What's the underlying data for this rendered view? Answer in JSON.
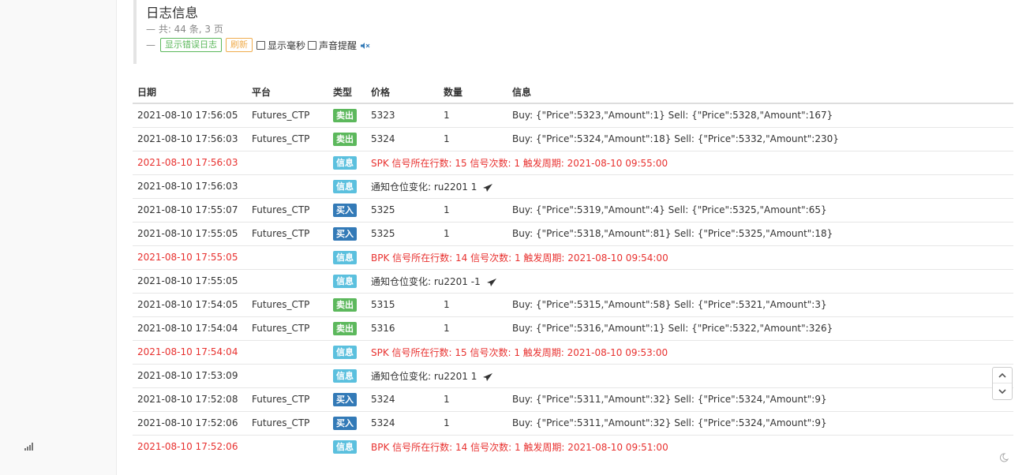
{
  "header": {
    "title": "日志信息",
    "summary": "— 共: 44 条, 3 页",
    "dash": "—",
    "show_error_label": "显示错误日志",
    "refresh_label": "刷新",
    "show_ms_label": "显示毫秒",
    "sound_alert_label": "声音提醒"
  },
  "table": {
    "columns": {
      "date": "日期",
      "platform": "平台",
      "type": "类型",
      "price": "价格",
      "quantity": "数量",
      "info": "信息"
    },
    "rows": [
      {
        "date": "2021-08-10 17:56:05",
        "platform": "Futures_CTP",
        "type": "卖出",
        "price": "5323",
        "quantity": "1",
        "info": "Buy: {\"Price\":5323,\"Amount\":1} Sell: {\"Price\":5328,\"Amount\":167}"
      },
      {
        "date": "2021-08-10 17:56:03",
        "platform": "Futures_CTP",
        "type": "卖出",
        "price": "5324",
        "quantity": "1",
        "info": "Buy: {\"Price\":5324,\"Amount\":18} Sell: {\"Price\":5332,\"Amount\":230}"
      },
      {
        "date": "2021-08-10 17:56:03",
        "platform": "",
        "type": "信息",
        "price": "",
        "quantity": "",
        "info": "SPK 信号所在行数: 15 信号次数: 1 触发周期: 2021-08-10 09:55:00"
      },
      {
        "date": "2021-08-10 17:56:03",
        "platform": "",
        "type": "信息",
        "price": "",
        "quantity": "",
        "info": "通知仓位变化: ru2201 1"
      },
      {
        "date": "2021-08-10 17:55:07",
        "platform": "Futures_CTP",
        "type": "买入",
        "price": "5325",
        "quantity": "1",
        "info": "Buy: {\"Price\":5319,\"Amount\":4} Sell: {\"Price\":5325,\"Amount\":65}"
      },
      {
        "date": "2021-08-10 17:55:05",
        "platform": "Futures_CTP",
        "type": "买入",
        "price": "5325",
        "quantity": "1",
        "info": "Buy: {\"Price\":5318,\"Amount\":81} Sell: {\"Price\":5325,\"Amount\":18}"
      },
      {
        "date": "2021-08-10 17:55:05",
        "platform": "",
        "type": "信息",
        "price": "",
        "quantity": "",
        "info": "BPK 信号所在行数: 14 信号次数: 1 触发周期: 2021-08-10 09:54:00"
      },
      {
        "date": "2021-08-10 17:55:05",
        "platform": "",
        "type": "信息",
        "price": "",
        "quantity": "",
        "info": "通知仓位变化: ru2201 -1"
      },
      {
        "date": "2021-08-10 17:54:05",
        "platform": "Futures_CTP",
        "type": "卖出",
        "price": "5315",
        "quantity": "1",
        "info": "Buy: {\"Price\":5315,\"Amount\":58} Sell: {\"Price\":5321,\"Amount\":3}"
      },
      {
        "date": "2021-08-10 17:54:04",
        "platform": "Futures_CTP",
        "type": "卖出",
        "price": "5316",
        "quantity": "1",
        "info": "Buy: {\"Price\":5316,\"Amount\":1} Sell: {\"Price\":5322,\"Amount\":326}"
      },
      {
        "date": "2021-08-10 17:54:04",
        "platform": "",
        "type": "信息",
        "price": "",
        "quantity": "",
        "info": "SPK 信号所在行数: 15 信号次数: 1 触发周期: 2021-08-10 09:53:00"
      },
      {
        "date": "2021-08-10 17:53:09",
        "platform": "",
        "type": "信息",
        "price": "",
        "quantity": "",
        "info": "通知仓位变化: ru2201 1"
      },
      {
        "date": "2021-08-10 17:52:08",
        "platform": "Futures_CTP",
        "type": "买入",
        "price": "5324",
        "quantity": "1",
        "info": "Buy: {\"Price\":5311,\"Amount\":32} Sell: {\"Price\":5324,\"Amount\":9}"
      },
      {
        "date": "2021-08-10 17:52:06",
        "platform": "Futures_CTP",
        "type": "买入",
        "price": "5324",
        "quantity": "1",
        "info": "Buy: {\"Price\":5311,\"Amount\":32} Sell: {\"Price\":5324,\"Amount\":9}"
      },
      {
        "date": "2021-08-10 17:52:06",
        "platform": "",
        "type": "信息",
        "price": "",
        "quantity": "",
        "info": "BPK 信号所在行数: 14 信号次数: 1 触发周期: 2021-08-10 09:51:00"
      }
    ]
  },
  "colors": {
    "sell_tag": "#5cb85c",
    "buy_tag": "#337ab7",
    "info_tag": "#5bc0de",
    "signal_text": "#e8312f",
    "refresh_button": "#f0ad4e",
    "error_log_button": "#5cb85c"
  },
  "icons": {
    "left_rail": "signal-bars-icon",
    "sound": "mute-speaker-icon",
    "notify": "paper-plane-icon",
    "scroll_up": "chevron-up-icon",
    "scroll_down": "chevron-down-icon",
    "theme": "moon-icon"
  }
}
